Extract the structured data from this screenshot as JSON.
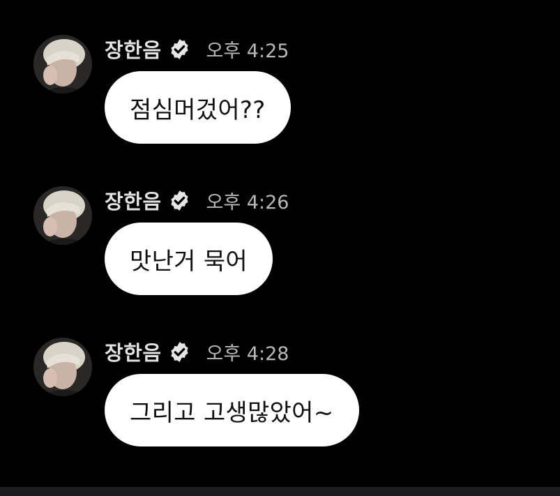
{
  "colors": {
    "background": "#000000",
    "bubble": "#ffffff",
    "bubble_text": "#111111",
    "name_text": "#e2e2e2",
    "time_text": "#b8b8b8",
    "verified_badge": "#e6e6e6"
  },
  "messages": [
    {
      "sender": "장한음",
      "verified_icon": "verified-badge-icon",
      "time": "오후 4:25",
      "text": "점심머겄어??"
    },
    {
      "sender": "장한음",
      "verified_icon": "verified-badge-icon",
      "time": "오후 4:26",
      "text": "맛난거 묵어"
    },
    {
      "sender": "장한음",
      "verified_icon": "verified-badge-icon",
      "time": "오후 4:28",
      "text": "그리고 고생많았어~"
    }
  ]
}
